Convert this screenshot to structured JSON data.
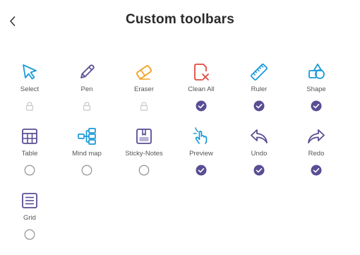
{
  "header": {
    "title": "Custom toolbars"
  },
  "colors": {
    "blue": "#1a9ad8",
    "purple": "#5a4d94",
    "orange": "#f0a020",
    "red": "#e04a3f",
    "check": "#5a4d94",
    "lock": "#c8c8c8"
  },
  "tools": [
    {
      "id": "select",
      "label": "Select",
      "icon": "cursor-icon",
      "state": "locked"
    },
    {
      "id": "pen",
      "label": "Pen",
      "icon": "pen-icon",
      "state": "locked"
    },
    {
      "id": "eraser",
      "label": "Eraser",
      "icon": "eraser-icon",
      "state": "locked"
    },
    {
      "id": "clean-all",
      "label": "Clean All",
      "icon": "clean-all-icon",
      "state": "checked"
    },
    {
      "id": "ruler",
      "label": "Ruler",
      "icon": "ruler-icon",
      "state": "checked"
    },
    {
      "id": "shape",
      "label": "Shape",
      "icon": "shape-icon",
      "state": "checked"
    },
    {
      "id": "table",
      "label": "Table",
      "icon": "table-icon",
      "state": "unchecked"
    },
    {
      "id": "mind-map",
      "label": "Mind map",
      "icon": "mind-map-icon",
      "state": "unchecked"
    },
    {
      "id": "sticky-notes",
      "label": "Sticky-Notes",
      "icon": "sticky-notes-icon",
      "state": "unchecked"
    },
    {
      "id": "preview",
      "label": "Preview",
      "icon": "touch-icon",
      "state": "checked"
    },
    {
      "id": "undo",
      "label": "Undo",
      "icon": "undo-icon",
      "state": "checked"
    },
    {
      "id": "redo",
      "label": "Redo",
      "icon": "redo-icon",
      "state": "checked"
    },
    {
      "id": "grid",
      "label": "Grid",
      "icon": "grid-icon",
      "state": "unchecked"
    }
  ]
}
